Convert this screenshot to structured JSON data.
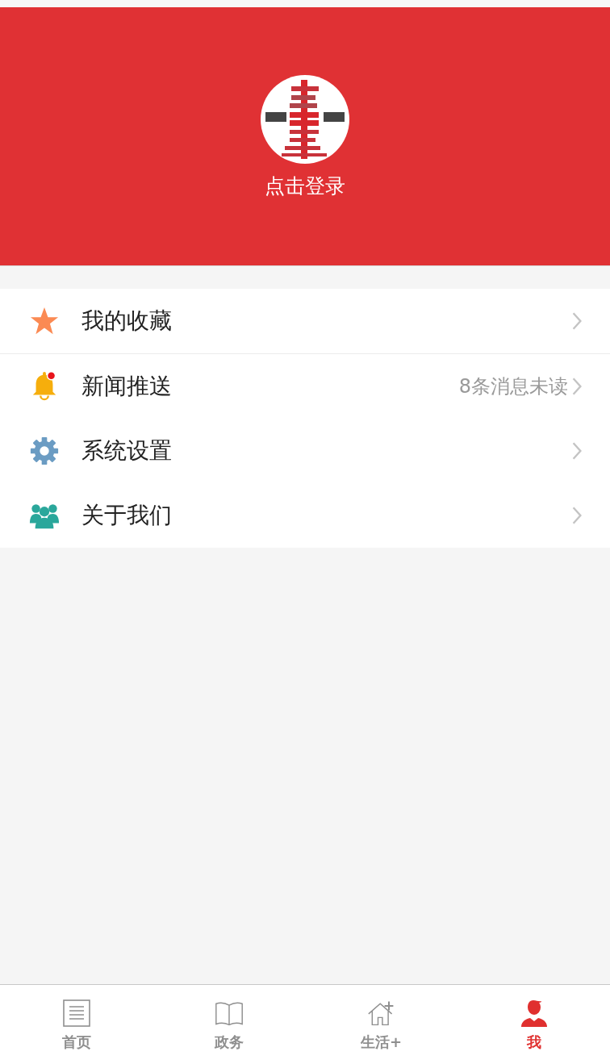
{
  "header": {
    "login_label": "点击登录"
  },
  "menu": [
    {
      "kind": "star",
      "label": "我的收藏"
    },
    {
      "kind": "bell",
      "label": "新闻推送",
      "note": "8条消息未读"
    },
    {
      "kind": "gear",
      "label": "系统设置"
    },
    {
      "kind": "people",
      "label": "关于我们"
    }
  ],
  "tab_bar": [
    {
      "kind": "news",
      "label": "首页",
      "selected": false
    },
    {
      "kind": "book",
      "label": "政务",
      "selected": false
    },
    {
      "kind": "house",
      "label": "生活+",
      "selected": false
    },
    {
      "kind": "person",
      "label": "我",
      "selected": true
    }
  ]
}
